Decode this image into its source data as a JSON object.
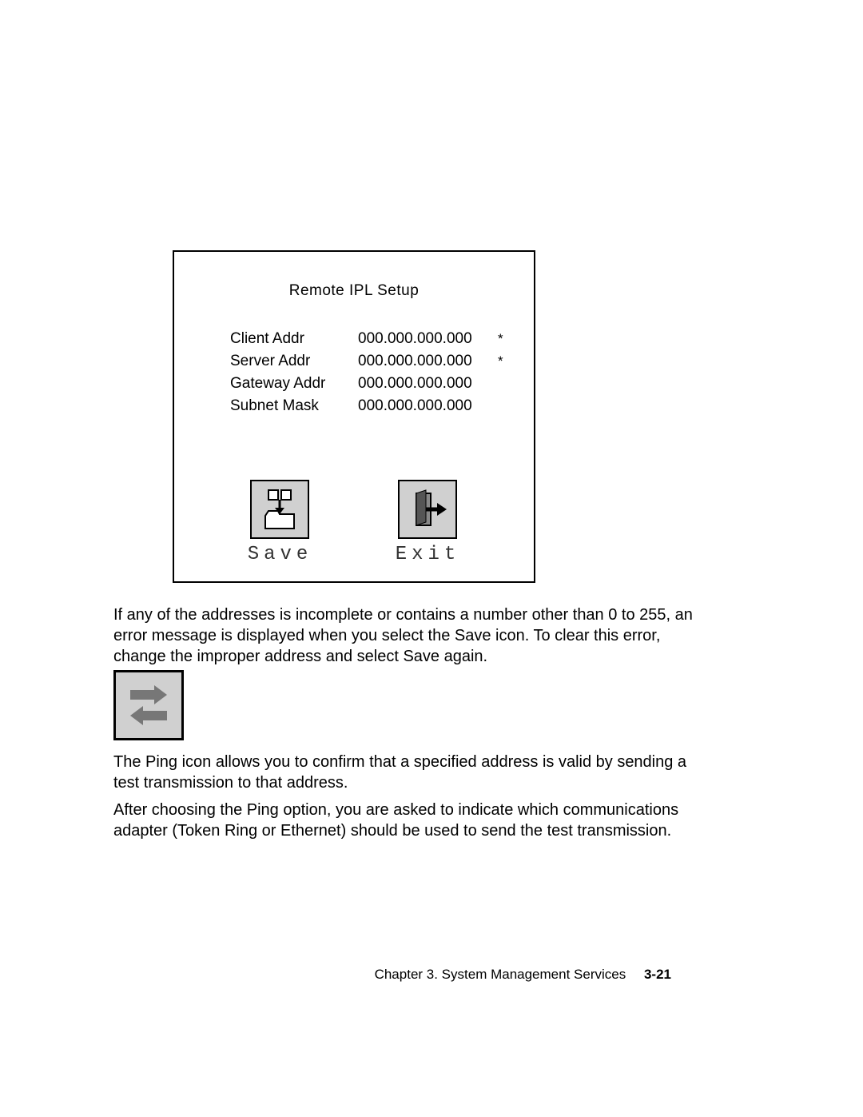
{
  "panel": {
    "title": "Remote  IPL  Setup",
    "rows": [
      {
        "label": "Client  Addr",
        "value": "000.000.000.000",
        "mark": "*"
      },
      {
        "label": "Server  Addr",
        "value": "000.000.000.000",
        "mark": "*"
      },
      {
        "label": "Gateway  Addr",
        "value": "000.000.000.000",
        "mark": ""
      },
      {
        "label": "Subnet  Mask",
        "value": "000.000.000.000",
        "mark": ""
      }
    ],
    "buttons": {
      "save": "Save",
      "exit": "Exit"
    }
  },
  "paragraphs": {
    "p1": "If any of the addresses is incomplete or contains a number other than 0 to 255, an error message is displayed when you select the Save icon.  To clear this error, change the improper address and select Save again.",
    "p2": "The Ping icon allows you to confirm that a specified address is valid by sending a test transmission to that address.",
    "p3": "After choosing the Ping option, you are asked to indicate which communications adapter (Token Ring or Ethernet) should be used to send the test transmission."
  },
  "footer": {
    "chapter": "Chapter 3.  System Management Services",
    "page": "3-21"
  }
}
